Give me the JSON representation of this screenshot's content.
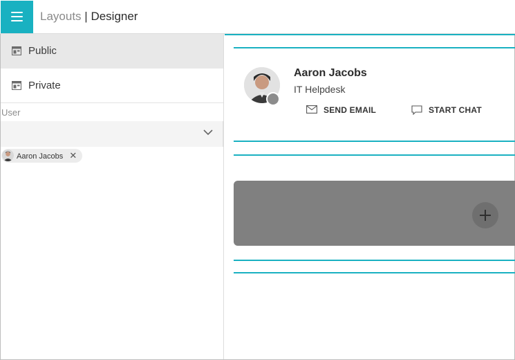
{
  "header": {
    "menu_icon": "hamburger-icon",
    "title_muted": "Layouts",
    "title_separator": "|",
    "title_strong": "Designer",
    "accent_color": "#19b1c1"
  },
  "sidebar": {
    "items": [
      {
        "label": "Public",
        "icon": "layout-icon",
        "active": true
      },
      {
        "label": "Private",
        "icon": "layout-icon",
        "active": false
      }
    ],
    "user_label": "User",
    "select_value": "",
    "chip": {
      "label": "Aaron Jacobs",
      "remove": "✕"
    }
  },
  "profile": {
    "name": "Aaron Jacobs",
    "department": "IT Helpdesk",
    "presence_color": "#8c8c8c",
    "actions": {
      "email": "SEND EMAIL",
      "chat": "START CHAT"
    }
  },
  "panel": {
    "add_icon": "plus-icon"
  }
}
